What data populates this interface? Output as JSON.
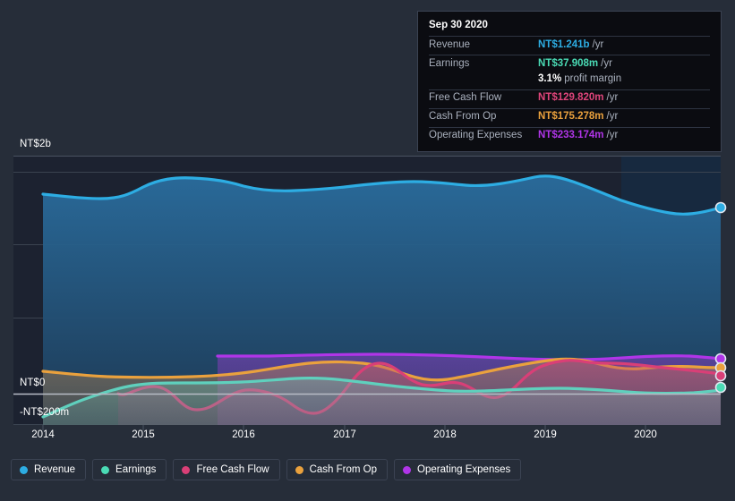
{
  "tooltip": {
    "title": "Sep 30 2020",
    "rows": [
      {
        "label": "Revenue",
        "value": "NT$1.241b",
        "suffix": "/yr",
        "color": "#2dade3"
      },
      {
        "label": "Earnings",
        "value": "NT$37.908m",
        "suffix": "/yr",
        "color": "#4adbb5"
      },
      {
        "label": "",
        "value": "3.1%",
        "suffix": "profit margin",
        "color": "#ffffff"
      },
      {
        "label": "Free Cash Flow",
        "value": "NT$129.820m",
        "suffix": "/yr",
        "color": "#e0457b"
      },
      {
        "label": "Cash From Op",
        "value": "NT$175.278m",
        "suffix": "/yr",
        "color": "#eaa13d"
      },
      {
        "label": "Operating Expenses",
        "value": "NT$233.174m",
        "suffix": "/yr",
        "color": "#b035e8"
      }
    ]
  },
  "legend": {
    "items": [
      {
        "label": "Revenue",
        "color": "#2dade3"
      },
      {
        "label": "Earnings",
        "color": "#4adbb5"
      },
      {
        "label": "Free Cash Flow",
        "color": "#d93f77"
      },
      {
        "label": "Cash From Op",
        "color": "#eaa13d"
      },
      {
        "label": "Operating Expenses",
        "color": "#b035e8"
      }
    ]
  },
  "axes": {
    "y_labels": [
      "NT$2b",
      "NT$0",
      "-NT$200m"
    ],
    "x_labels": [
      "2014",
      "2015",
      "2016",
      "2017",
      "2018",
      "2019",
      "2020"
    ]
  },
  "chart_data": {
    "type": "area",
    "title": "",
    "xlabel": "",
    "ylabel": "",
    "currency": "NT$",
    "ylim": [
      -200000000,
      2000000000
    ],
    "y_ticks": [
      {
        "label": "NT$2b",
        "value": 2000000000
      },
      {
        "label": "NT$0",
        "value": 0
      },
      {
        "label": "-NT$200m",
        "value": -200000000
      }
    ],
    "grid": true,
    "legend_position": "bottom",
    "x": [
      "2014",
      "2015",
      "2016",
      "2017",
      "2018",
      "2019",
      "2020",
      "2020-09-30"
    ],
    "x_tick_labels": [
      "2014",
      "2015",
      "2016",
      "2017",
      "2018",
      "2019",
      "2020"
    ],
    "forecast_region_start": "2019.7",
    "series": [
      {
        "name": "Revenue",
        "color": "#2dade3",
        "unit": "NT$",
        "latest_value": 1241000000,
        "latest_label": "NT$1.241b",
        "values": [
          1582000000,
          1545000000,
          1610000000,
          1588000000,
          1590000000,
          1620000000,
          1500000000,
          1241000000
        ]
      },
      {
        "name": "Earnings",
        "color": "#4adbb5",
        "unit": "NT$",
        "latest_value": 37908000,
        "latest_label": "NT$37.908m",
        "profit_margin": "3.1%",
        "values": [
          -110000000,
          -8000000,
          6000000,
          -4000000,
          -20000000,
          -34000000,
          -24000000,
          37908000
        ]
      },
      {
        "name": "Free Cash Flow",
        "color": "#d93f77",
        "unit": "NT$",
        "latest_value": 129820000,
        "latest_label": "NT$129.820m",
        "values": [
          0,
          -5000000,
          -70000000,
          -30000000,
          -50000000,
          40000000,
          150000000,
          129820000
        ]
      },
      {
        "name": "Cash From Op",
        "color": "#eaa13d",
        "unit": "NT$",
        "latest_value": 175278000,
        "latest_label": "NT$175.278m",
        "values": [
          72000000,
          60000000,
          62000000,
          130000000,
          95000000,
          135000000,
          215000000,
          175278000
        ]
      },
      {
        "name": "Operating Expenses",
        "color": "#b035e8",
        "unit": "NT$",
        "latest_value": 233174000,
        "latest_label": "NT$233.174m",
        "start_x": "2015.75",
        "values": [
          null,
          null,
          258000000,
          258000000,
          252000000,
          250000000,
          262000000,
          233174000
        ]
      }
    ]
  }
}
